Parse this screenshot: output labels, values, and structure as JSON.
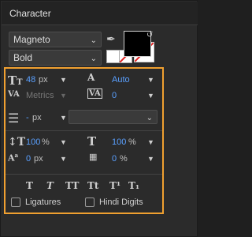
{
  "header": {
    "title": "Character"
  },
  "font": {
    "family": "Magneto",
    "style": "Bold"
  },
  "colors": {
    "fill": "#000000",
    "stroke": "#ffffff",
    "accent_highlight": "#f0a030",
    "value": "#5aa0ff"
  },
  "size": {
    "value": "48",
    "unit": "px"
  },
  "leading": {
    "value": "Auto"
  },
  "kerning": {
    "value": "Metrics"
  },
  "tracking": {
    "value": "0"
  },
  "stroke_width": {
    "value": "-",
    "unit": "px"
  },
  "vertical_scale": {
    "value": "100",
    "unit": "%"
  },
  "horizontal_scale": {
    "value": "100",
    "unit": "%"
  },
  "baseline_shift": {
    "value": "0",
    "unit": "px"
  },
  "tsume": {
    "value": "0",
    "unit": "%"
  },
  "style_buttons": [
    "T",
    "T",
    "TT",
    "Tt",
    "T¹",
    "T₁"
  ],
  "options": {
    "ligatures": "Ligatures",
    "hindi_digits": "Hindi Digits"
  }
}
